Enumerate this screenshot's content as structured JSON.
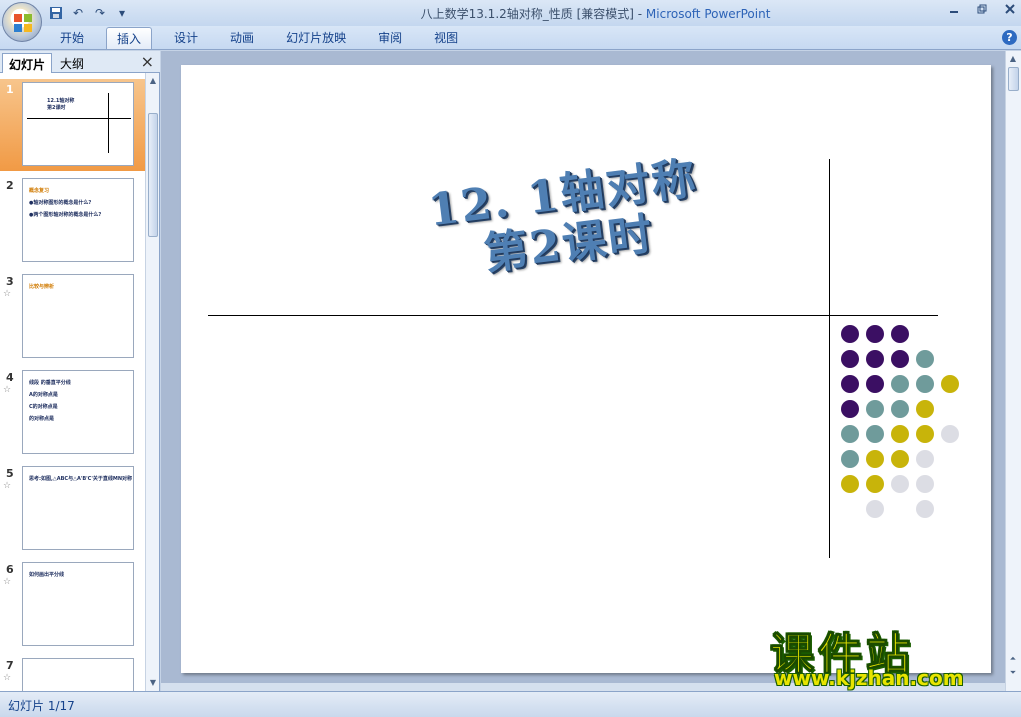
{
  "window": {
    "title": "八上数学13.1.2轴对称_性质 [兼容模式] - ",
    "app_name": "Microsoft PowerPoint",
    "controls": [
      "minimize-icon",
      "restore-icon",
      "close-icon"
    ]
  },
  "quick_access": [
    "save-icon",
    "undo-icon",
    "redo-icon",
    "customize-icon"
  ],
  "ribbon": {
    "tabs": [
      "开始",
      "插入",
      "设计",
      "动画",
      "幻灯片放映",
      "审阅",
      "视图"
    ],
    "active_tab": "插入"
  },
  "left_panel": {
    "tabs": [
      "幻灯片",
      "大纲"
    ],
    "active_tab": "幻灯片",
    "close_label": "×",
    "thumbnails": [
      {
        "num": "1",
        "anim": "",
        "lines": [
          "12.1轴对称",
          "第2课时"
        ]
      },
      {
        "num": "2",
        "anim": "",
        "lines": [
          "概念复习",
          "●轴对称图形的概念是什么?",
          "●两个图形轴对称的概念是什么?"
        ]
      },
      {
        "num": "3",
        "anim": "☆",
        "lines": [
          "比较与辨析"
        ]
      },
      {
        "num": "4",
        "anim": "☆",
        "lines": [
          "线段 的垂直平分线",
          "A的对称点是",
          "C的对称点是",
          "的对称点是"
        ]
      },
      {
        "num": "5",
        "anim": "☆",
        "lines": [
          "思考:如图,△ABC与△A'B'C'关于直线MN对称"
        ]
      },
      {
        "num": "6",
        "anim": "☆",
        "lines": [
          "如何画出平分线"
        ]
      },
      {
        "num": "7",
        "anim": "☆",
        "lines": []
      }
    ]
  },
  "slide": {
    "title_line1": "12. 1轴对称",
    "title_line2": "第2课时",
    "dot_colors": {
      "purple": "#3b0f63",
      "teal": "#6f9b9b",
      "gold": "#c8b40a",
      "grey": "#dcdde4"
    },
    "dot_grid": [
      [
        "purple",
        "purple",
        "purple",
        "",
        ""
      ],
      [
        "purple",
        "purple",
        "purple",
        "teal",
        ""
      ],
      [
        "purple",
        "purple",
        "teal",
        "teal",
        "gold"
      ],
      [
        "purple",
        "teal",
        "teal",
        "gold",
        ""
      ],
      [
        "teal",
        "teal",
        "gold",
        "gold",
        "grey"
      ],
      [
        "teal",
        "gold",
        "gold",
        "grey",
        ""
      ],
      [
        "gold",
        "gold",
        "grey",
        "grey",
        ""
      ],
      [
        "",
        "grey",
        "",
        "grey",
        ""
      ]
    ]
  },
  "status": {
    "slide_indicator": "幻灯片 1/17"
  },
  "watermark": {
    "text": "课件站",
    "url": "www.kjzhan.com"
  }
}
